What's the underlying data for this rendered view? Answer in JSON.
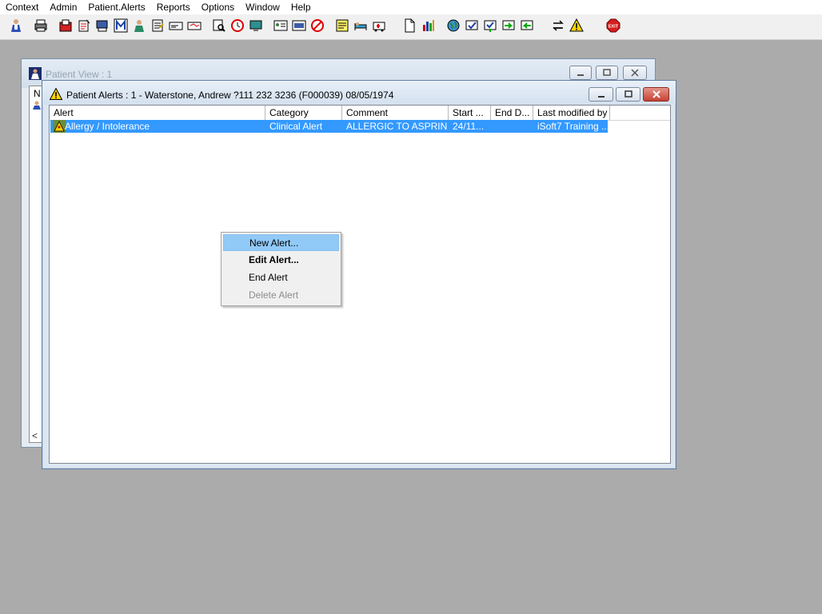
{
  "menubar": {
    "items": [
      "Context",
      "Admin",
      "Patient.Alerts",
      "Reports",
      "Options",
      "Window",
      "Help"
    ]
  },
  "toolbar": {
    "buttons": [
      "patient-icon",
      "printer-icon",
      "folder-red-icon",
      "notepad-icon",
      "screen-print-icon",
      "m-icon",
      "doctor-icon",
      "form-icon",
      "card-icon",
      "card2-icon",
      "magnify-doc-icon",
      "clock-icon",
      "monitor-icon",
      "id-card-icon",
      "chart-card-icon",
      "no-entry-icon",
      "notes-icon",
      "bed-icon",
      "ambulance-icon",
      "blank-doc-icon",
      "bar-chart-icon",
      "globe-icon",
      "check-doc-icon",
      "check-arrow-icon",
      "green-arrow-icon",
      "green-arrow2-icon",
      "swap-arrows-icon",
      "warning-icon",
      "exit-icon"
    ],
    "exit_label": "EXIT"
  },
  "patient_view": {
    "title": "Patient View : 1",
    "col_fragment": "N",
    "scroll_glyph": "<"
  },
  "alerts_window": {
    "title": "Patient Alerts : 1 - Waterstone, Andrew ?111 232 3236 (F000039) 08/05/1974",
    "columns": [
      "Alert",
      "Category",
      "Comment",
      "Start ...",
      "End D...",
      "Last modified by"
    ],
    "rows": [
      {
        "alert": "Allergy / Intolerance",
        "category": "Clinical Alert",
        "comment": "ALLERGIC TO ASPRIN",
        "start": "24/11...",
        "end": "",
        "modified_by": "iSoft7 Training ..."
      }
    ]
  },
  "context_menu": {
    "items": [
      {
        "label": "New Alert...",
        "state": "hover"
      },
      {
        "label": "Edit Alert...",
        "state": "bold"
      },
      {
        "label": "End Alert",
        "state": "normal"
      },
      {
        "label": "Delete Alert",
        "state": "disabled"
      }
    ]
  },
  "colors": {
    "desktop": "#ababab",
    "selection": "#3399ff",
    "menu_hover": "#91c9f7",
    "close_button": "#c64333"
  }
}
